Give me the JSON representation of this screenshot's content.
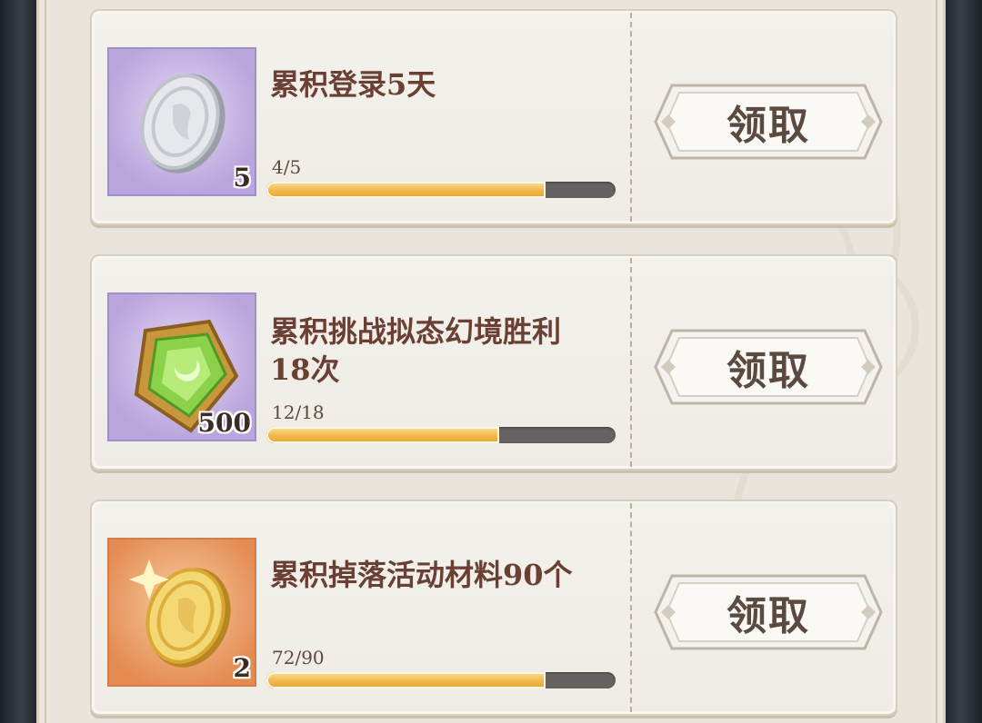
{
  "tasks": [
    {
      "title": "累积登录5天",
      "progress_text": "4/5",
      "progress": 0.8,
      "reward_icon": "silver-coin-icon",
      "reward_qty": "5",
      "claim_label": "领取"
    },
    {
      "title": "累积挑战拟态幻境胜利\n18次",
      "progress_text": "12/18",
      "progress": 0.667,
      "reward_icon": "green-crystal-icon",
      "reward_qty": "500",
      "claim_label": "领取"
    },
    {
      "title": "累积掉落活动材料90个",
      "progress_text": "72/90",
      "progress": 0.8,
      "reward_icon": "gold-coin-icon",
      "reward_qty": "2",
      "claim_label": "领取"
    }
  ],
  "colors": {
    "title": "#6b4034",
    "bar_fill": "#f0b84a",
    "bar_track": "#666260",
    "rare_bg": "#b9a4dc",
    "epic_bg": "#e48b52"
  }
}
